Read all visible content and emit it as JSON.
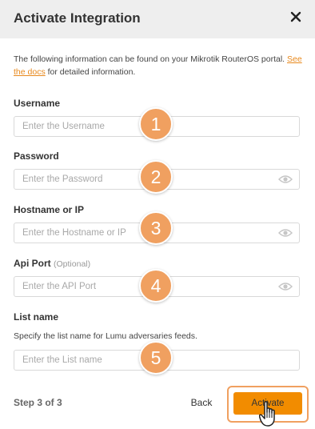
{
  "dialog": {
    "title": "Activate Integration",
    "close_icon": "close-icon"
  },
  "intro": {
    "text_before": "The following information can be found on your Mikrotik RouterOS portal.",
    "link": "See the docs",
    "text_after": "for detailed information."
  },
  "fields": {
    "username": {
      "label": "Username",
      "placeholder": "Enter the Username",
      "badge": "1"
    },
    "password": {
      "label": "Password",
      "placeholder": "Enter the Password",
      "badge": "2",
      "icon": "eye-icon"
    },
    "hostname": {
      "label": "Hostname or IP",
      "placeholder": "Enter the Hostname or IP",
      "badge": "3",
      "icon": "eye-icon"
    },
    "api_port": {
      "label": "Api Port",
      "optional": "(Optional)",
      "placeholder": "Enter the API Port",
      "badge": "4",
      "icon": "eye-icon"
    },
    "list_name": {
      "label": "List name",
      "helper": "Specify the list name for Lumu adversaries feeds.",
      "placeholder": "Enter the List name",
      "badge": "5"
    }
  },
  "footer": {
    "step": "Step 3 of 3",
    "back": "Back",
    "activate": "Activate"
  },
  "colors": {
    "accent": "#f28c00",
    "badge": "#f0a060",
    "link": "#e8891d",
    "header_bg": "#eeeeee"
  }
}
